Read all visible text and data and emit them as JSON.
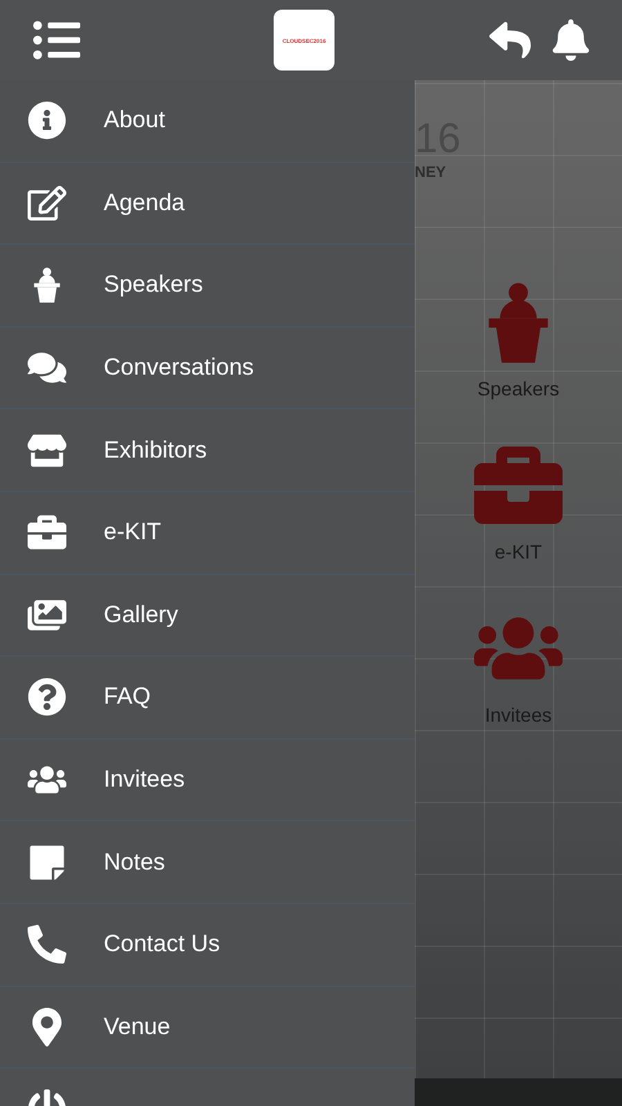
{
  "header": {
    "logo_text": "CLOUDSEC2016"
  },
  "background": {
    "fragments": [
      "16",
      "NEY"
    ],
    "tiles": [
      {
        "label": "Speakers"
      },
      {
        "label": "e-KIT"
      },
      {
        "label": "Invitees"
      }
    ]
  },
  "drawer": {
    "items": [
      {
        "label": "About"
      },
      {
        "label": "Agenda"
      },
      {
        "label": "Speakers"
      },
      {
        "label": "Conversations"
      },
      {
        "label": "Exhibitors"
      },
      {
        "label": "e-KIT"
      },
      {
        "label": "Gallery"
      },
      {
        "label": "FAQ"
      },
      {
        "label": "Invitees"
      },
      {
        "label": "Notes"
      },
      {
        "label": "Contact Us"
      },
      {
        "label": "Venue"
      }
    ]
  }
}
